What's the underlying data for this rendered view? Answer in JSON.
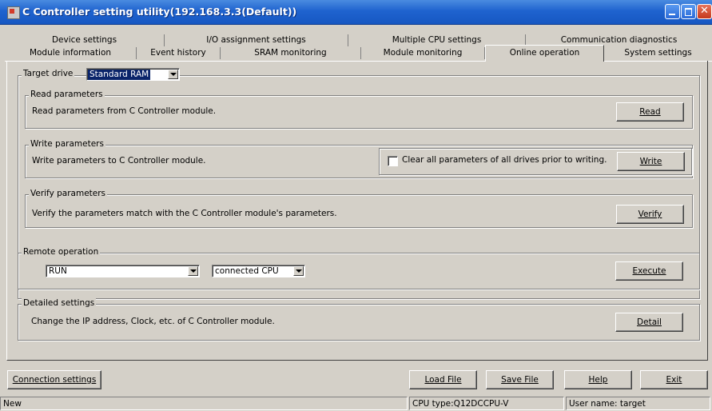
{
  "window": {
    "title": "C Controller setting utility(192.168.3.3(Default))"
  },
  "tabs": {
    "row1": [
      "Device settings",
      "I/O assignment settings",
      "Multiple CPU settings",
      "Communication diagnostics"
    ],
    "row2": [
      "Module information",
      "Event history",
      "SRAM monitoring",
      "Module monitoring",
      "Online operation",
      "System settings"
    ],
    "active": "Online operation"
  },
  "target_drive": {
    "label": "Target drive",
    "value": "Standard RAM"
  },
  "read_group": {
    "legend": "Read parameters",
    "description": "Read parameters from C Controller module.",
    "button": "Read"
  },
  "write_group": {
    "legend": "Write parameters",
    "description": "Write parameters to C Controller module.",
    "checkbox_label": "Clear all parameters of all drives prior to writing.",
    "checkbox_checked": false,
    "button": "Write"
  },
  "verify_group": {
    "legend": "Verify parameters",
    "description": "Verify the parameters match with the C Controller module's parameters.",
    "button": "Verify"
  },
  "remote_group": {
    "legend": "Remote operation",
    "operation_value": "RUN",
    "target_value": "connected CPU",
    "button": "Execute"
  },
  "detail_group": {
    "legend": "Detailed settings",
    "description": "Change the IP address, Clock, etc. of C Controller module.",
    "button": "Detail"
  },
  "footer": {
    "connection_button": "Connection settings",
    "load_button": "Load File",
    "save_button": "Save File",
    "help_button": "Help",
    "exit_button": "Exit"
  },
  "status": {
    "mode": "New",
    "cpu_type": "CPU type:Q12DCCPU-V",
    "user": "User name: target"
  },
  "colors": {
    "titlebar": "#1f63cf",
    "face": "#d4d0c8",
    "combo_highlight": "#0a246a"
  }
}
